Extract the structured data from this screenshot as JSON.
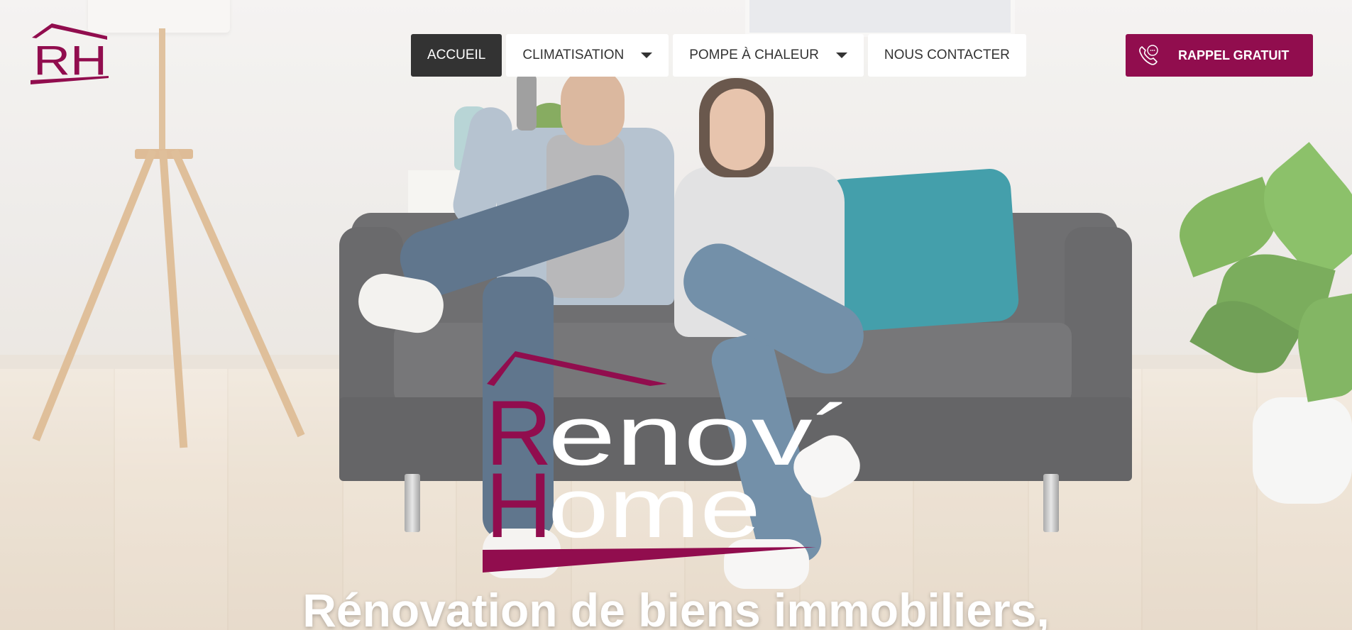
{
  "brand": {
    "logo_letters": "RH",
    "color": "#910d4e",
    "wordmark_line1_initial": "R",
    "wordmark_line1_rest": "enov´",
    "wordmark_line2_initial": "H",
    "wordmark_line2_rest": "ome"
  },
  "nav": {
    "items": [
      {
        "label": "ACCUEIL",
        "active": true,
        "has_dropdown": false
      },
      {
        "label": "CLIMATISATION",
        "active": false,
        "has_dropdown": true
      },
      {
        "label": "POMPE À CHALEUR",
        "active": false,
        "has_dropdown": true
      },
      {
        "label": "NOUS CONTACTER",
        "active": false,
        "has_dropdown": false
      }
    ]
  },
  "cta": {
    "label": "RAPPEL GRATUIT",
    "icon": "phone-icon"
  },
  "hero": {
    "headline": "Rénovation de biens immobiliers,"
  }
}
